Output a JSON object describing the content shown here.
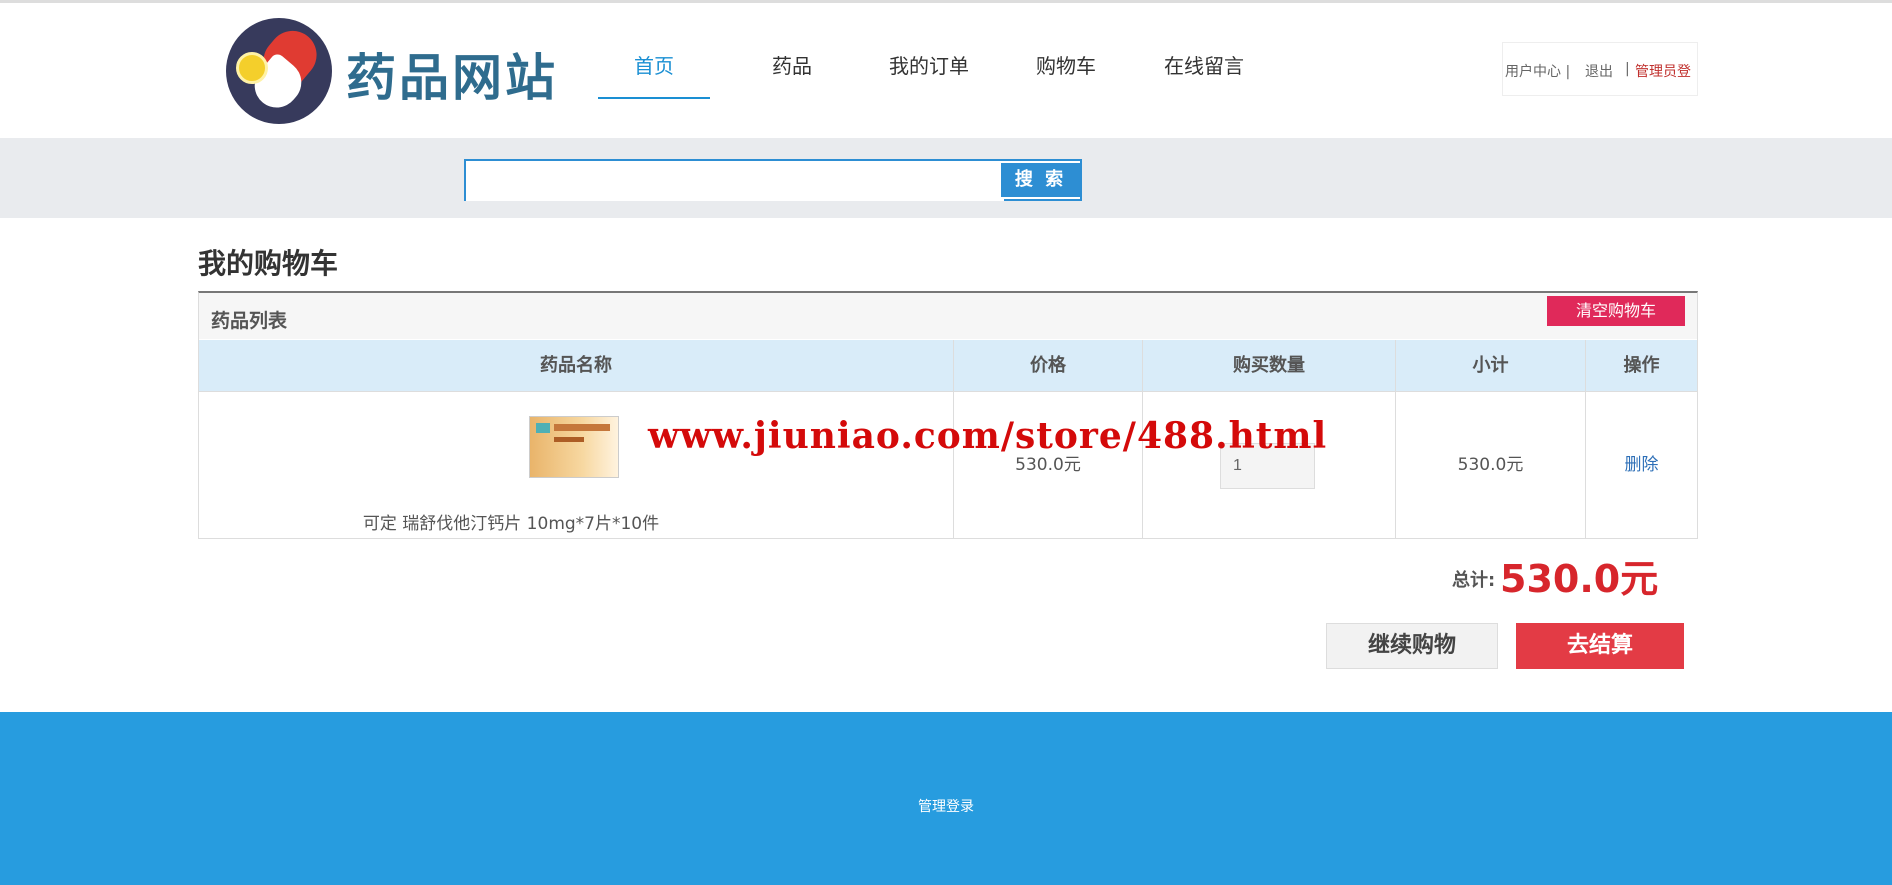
{
  "header": {
    "site_name": "药品网站",
    "nav": [
      "首页",
      "药品",
      "我的订单",
      "购物车",
      "在线留言"
    ],
    "user_links": [
      "用户中心 |",
      "退出",
      "|",
      "管理员登"
    ]
  },
  "search": {
    "placeholder": "",
    "button_label": "搜 索"
  },
  "cart": {
    "title": "我的购物车",
    "panel_title": "药品列表",
    "clear_button": "清空购物车",
    "columns": [
      "药品名称",
      "价格",
      "购买数量",
      "小计",
      "操作"
    ],
    "rows": [
      {
        "name": "可定 瑞舒伐他汀钙片 10mg*7片*10件",
        "price": "530.0元",
        "quantity": "1",
        "subtotal": "530.0元",
        "action": "删除"
      }
    ],
    "total_label": "总计:",
    "total_value": "530.0元",
    "continue_button": "继续购物",
    "checkout_button": "去结算"
  },
  "watermark": "www.jiuniao.com/store/488.html",
  "footer": {
    "link": "管理登录"
  },
  "colors": {
    "accent": "#279cdf",
    "danger": "#e33b45",
    "clear": "#e0295a"
  }
}
